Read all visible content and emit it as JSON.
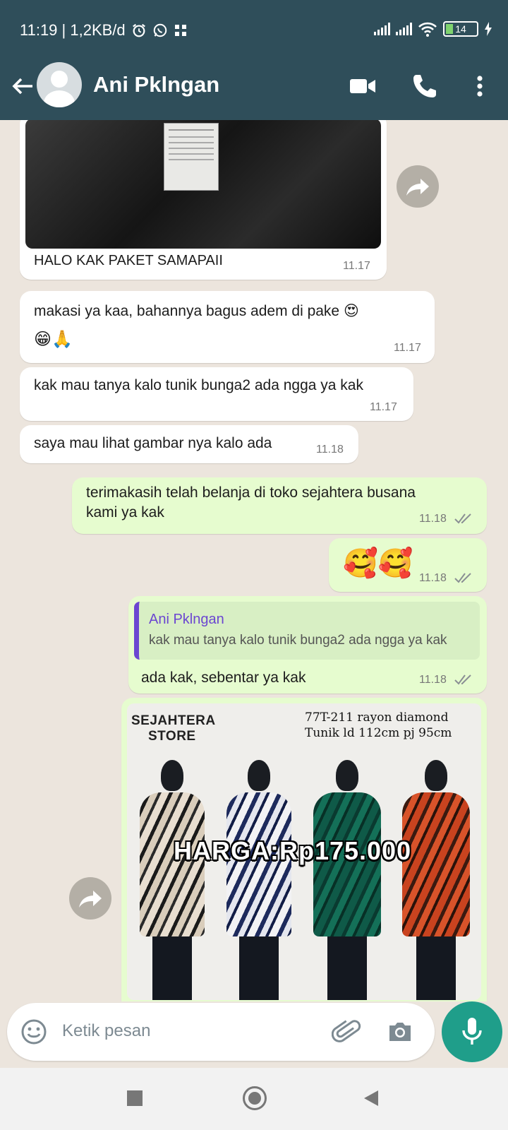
{
  "status": {
    "left_text": "11:19 | 1,2KB/d",
    "battery": "14"
  },
  "header": {
    "contact_name": "Ani Pklngan"
  },
  "messages": [
    {
      "text": "HALO KAK PAKET SAMAPAII",
      "time": "11.17"
    },
    {
      "text": "makasi ya kaa, bahannya bagus adem di pake 😍",
      "text2": "😁🙏",
      "time": "11.17"
    },
    {
      "text": "kak mau tanya kalo tunik bunga2 ada ngga ya kak",
      "time": "11.17"
    },
    {
      "text": "saya mau lihat gambar nya kalo ada",
      "time": "11.18"
    },
    {
      "text": "terimakasih telah belanja di toko sejahtera busana",
      "text2": "kami ya kak",
      "time": "11.18"
    },
    {
      "text": "🥰🥰",
      "time": "11.18"
    },
    {
      "quote_author": "Ani Pklngan",
      "quote_text": "kak mau tanya kalo tunik bunga2 ada ngga ya kak",
      "text": "ada kak, sebentar ya kak",
      "time": "11.18"
    }
  ],
  "product_image": {
    "store_line1": "SEJAHTERA",
    "store_line2": "STORE",
    "info_line1": "77T-211 rayon diamond",
    "info_line2": "Tunik ld 112cm pj 95cm",
    "price": "HARGA:Rp175.000"
  },
  "input": {
    "placeholder": "Ketik pesan"
  },
  "colors": {
    "header": "#2f4e5a",
    "chat_bg": "#ece5dd",
    "outgoing": "#e6fccf",
    "accent": "#1f9e8a",
    "quote_bar": "#6b46d1"
  }
}
